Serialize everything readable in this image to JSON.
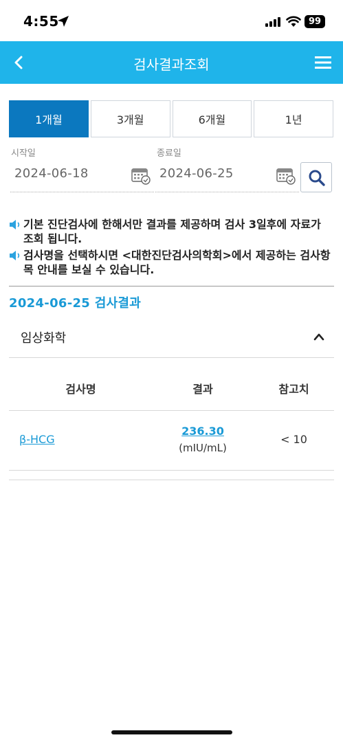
{
  "status_bar": {
    "time": "4:55",
    "battery": "99"
  },
  "header": {
    "title": "검사결과조회"
  },
  "period_tabs": [
    {
      "label": "1개월",
      "active": true
    },
    {
      "label": "3개월",
      "active": false
    },
    {
      "label": "6개월",
      "active": false
    },
    {
      "label": "1년",
      "active": false
    }
  ],
  "date_range": {
    "start_label": "시작일",
    "start_value": "2024-06-18",
    "end_label": "종료일",
    "end_value": "2024-06-25"
  },
  "notices": [
    "기본 진단검사에 한해서만 결과를 제공하며 검사 3일후에 자료가 조회 됩니다.",
    "검사명을 선택하시면 <대한진단검사의학회>에서 제공하는 검사항목 안내를 보실 수 있습니다."
  ],
  "results": {
    "date_title": "2024-06-25 검사결과",
    "section": "임상화학",
    "columns": [
      "검사명",
      "결과",
      "참고치"
    ],
    "rows": [
      {
        "name": "β-HCG",
        "value": "236.30",
        "unit": "(mIU/mL)",
        "reference": "< 10"
      }
    ]
  },
  "colors": {
    "header": "#1fb4ea",
    "active_tab": "#0b78bf",
    "link": "#1a9ad6"
  }
}
